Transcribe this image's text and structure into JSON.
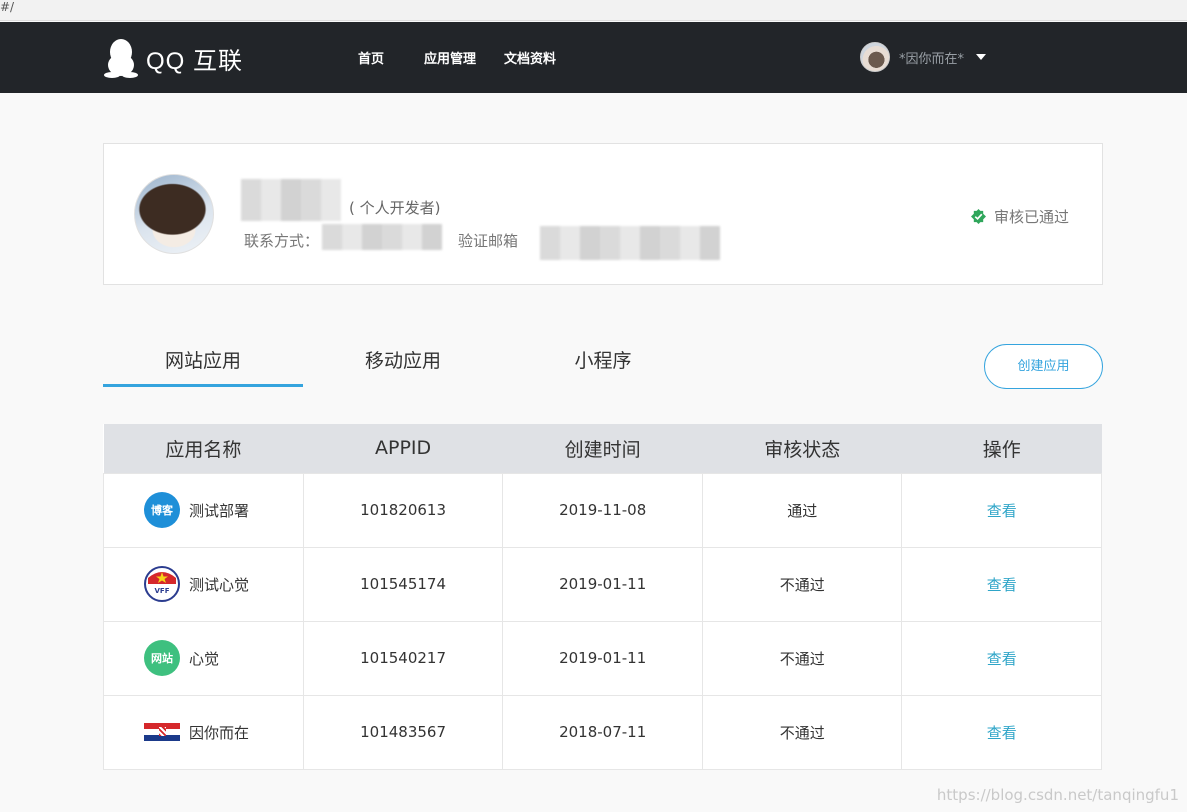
{
  "browser": {
    "url_fragment": "#/"
  },
  "nav": {
    "logo_text": "QQ 互联",
    "links": [
      "首页",
      "应用管理",
      "文档资料"
    ],
    "username": "*因你而在*"
  },
  "profile": {
    "dev_type": "( 个人开发者)",
    "contact_label": "联系方式：",
    "email_label": "验证邮箱",
    "verified_text": "审核已通过"
  },
  "tabs": [
    "网站应用",
    "移动应用",
    "小程序"
  ],
  "create_button": "创建应用",
  "table": {
    "headers": [
      "应用名称",
      "APPID",
      "创建时间",
      "审核状态",
      "操作"
    ],
    "rows": [
      {
        "icon": "blog-icon",
        "icon_text": "博客",
        "name": "测试部署",
        "appid": "101820613",
        "date": "2019-11-08",
        "status": "通过",
        "status_type": "pass",
        "action": "查看"
      },
      {
        "icon": "football-badge-icon",
        "icon_text": "VFF",
        "name": "测试心觉",
        "appid": "101545174",
        "date": "2019-01-11",
        "status": "不通过",
        "status_type": "fail",
        "action": "查看"
      },
      {
        "icon": "green-badge-icon",
        "icon_text": "网站",
        "name": "心觉",
        "appid": "101540217",
        "date": "2019-01-11",
        "status": "不通过",
        "status_type": "fail",
        "action": "查看"
      },
      {
        "icon": "croatia-flag-icon",
        "icon_text": "",
        "name": "因你而在",
        "appid": "101483567",
        "date": "2018-07-11",
        "status": "不通过",
        "status_type": "fail",
        "action": "查看"
      }
    ]
  },
  "watermark": "https://blog.csdn.net/tanqingfu1",
  "colors": {
    "accent": "#35a4de",
    "pass": "#2fa65b",
    "fail": "#e2493b",
    "nav_bg": "#222529"
  }
}
